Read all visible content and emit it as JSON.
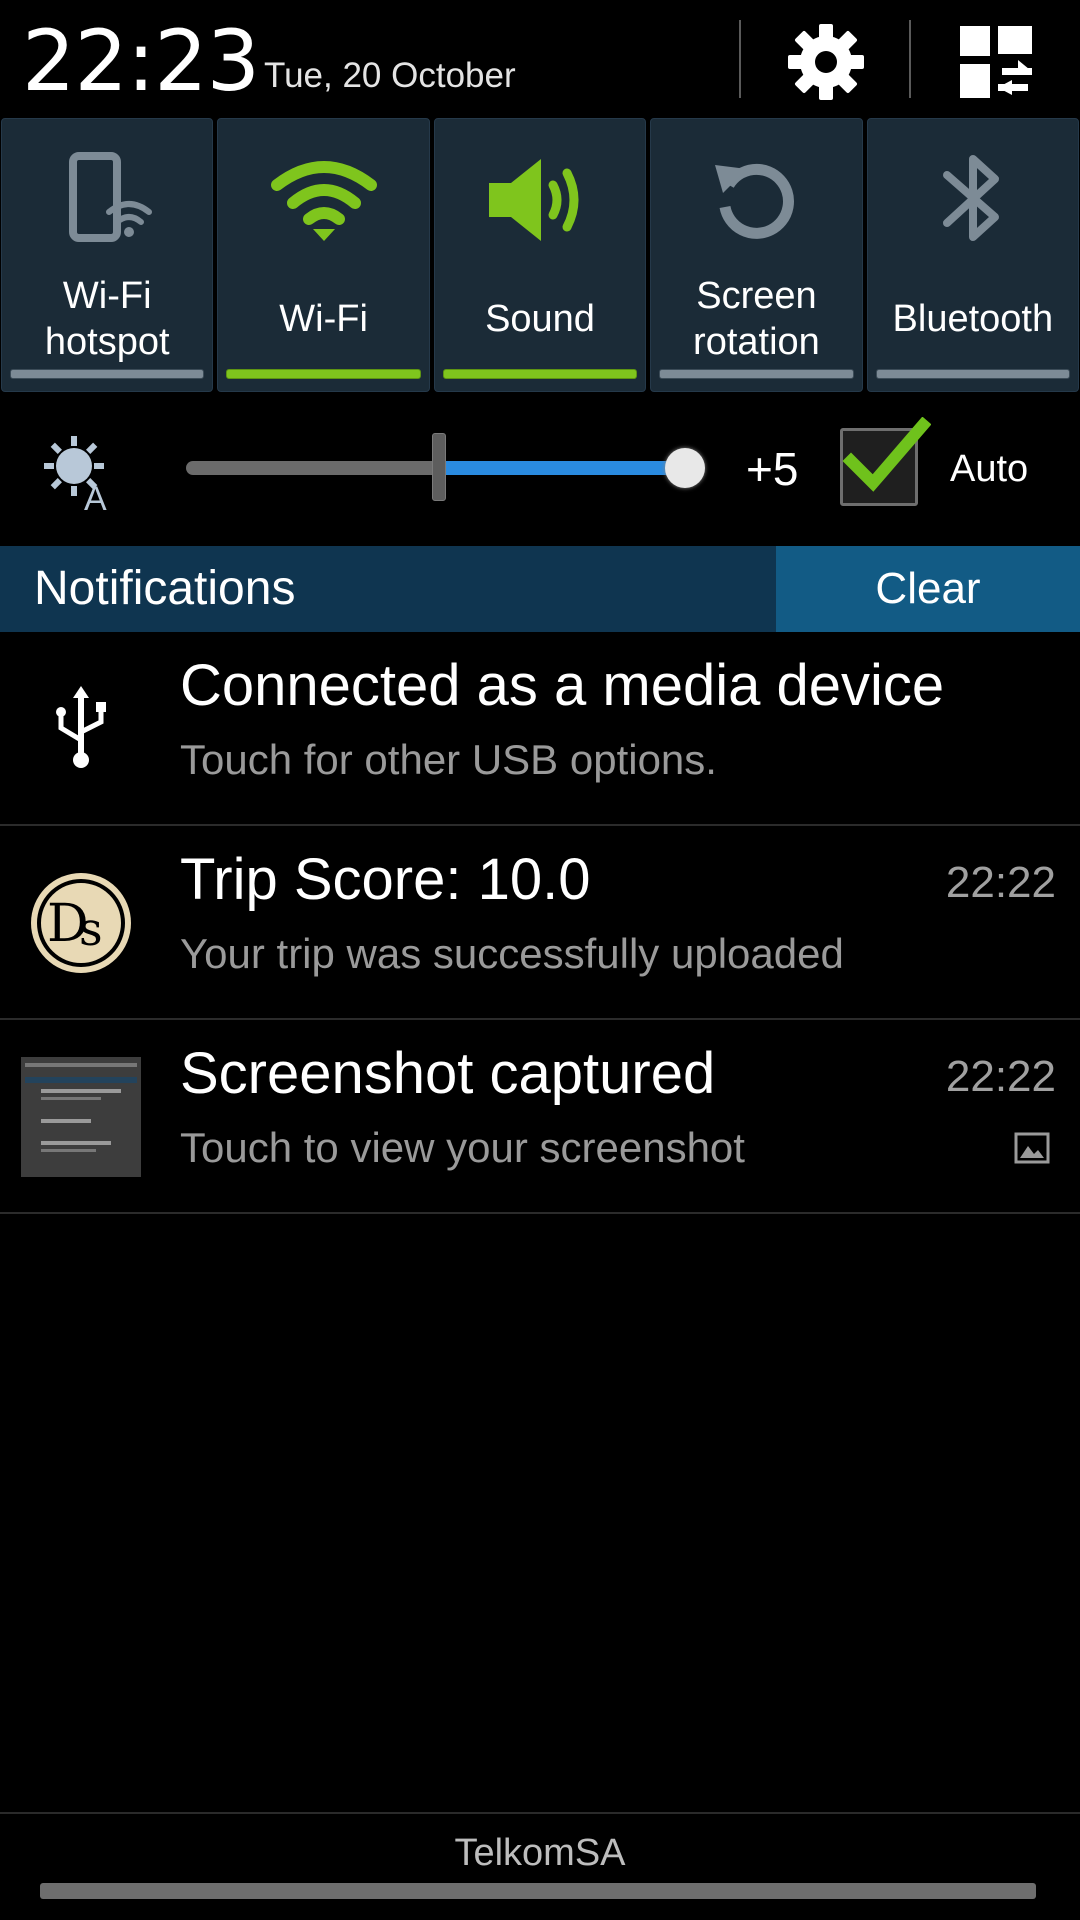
{
  "header": {
    "time": "22:23",
    "date": "Tue, 20 October",
    "settings_icon": "gear-icon",
    "edit_icon": "grid-swap-icon"
  },
  "toggles": [
    {
      "label": "Wi-Fi\nhotspot",
      "icon": "hotspot-icon",
      "state": "off"
    },
    {
      "label": "Wi-Fi",
      "icon": "wifi-icon",
      "state": "on"
    },
    {
      "label": "Sound",
      "icon": "speaker-icon",
      "state": "on"
    },
    {
      "label": "Screen\nrotation",
      "icon": "rotation-icon",
      "state": "off"
    },
    {
      "label": "Bluetooth",
      "icon": "bluetooth-icon",
      "state": "off"
    }
  ],
  "brightness": {
    "value_label": "+5",
    "auto_label": "Auto",
    "auto_checked": true,
    "level": 1.0,
    "icon": "brightness-auto-icon"
  },
  "notifications_header": {
    "title": "Notifications",
    "clear_label": "Clear"
  },
  "notifications": [
    {
      "title": "Connected as a media device",
      "subtitle": "Touch for other USB options.",
      "time": "",
      "icon": "usb-icon"
    },
    {
      "title": "Trip Score: 10.0",
      "subtitle": "Your trip was successfully uploaded",
      "time": "22:22",
      "icon": "ds-logo-icon"
    },
    {
      "title": "Screenshot captured",
      "subtitle": "Touch to view your screenshot",
      "time": "22:22",
      "icon": "screenshot-thumbnail",
      "small_icon": "image-icon"
    }
  ],
  "footer": {
    "carrier": "TelkomSA"
  },
  "colors": {
    "toggle_on": "#7fc51d",
    "toggle_off": "#7d8b96",
    "notif_bar": "#0f3550",
    "clear_bg": "#125b85",
    "slider_blue": "#2a8be0"
  }
}
